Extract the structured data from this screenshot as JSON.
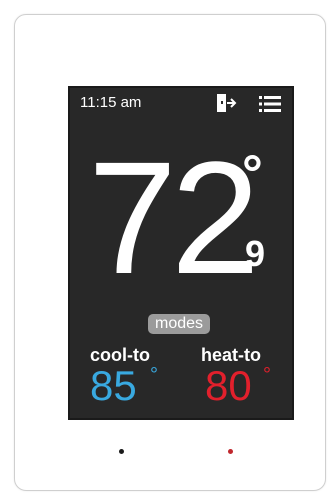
{
  "status_bar": {
    "time": "11:15 am",
    "icons": [
      "door-exit-icon",
      "menu-list-icon"
    ]
  },
  "current_temp": {
    "whole": "72",
    "degree_symbol": "°",
    "decimal": "9"
  },
  "modes_button": {
    "label": "modes"
  },
  "setpoints": {
    "cool": {
      "label": "cool-to",
      "value": "85",
      "degree_symbol": "°",
      "color": "#39a9e0"
    },
    "heat": {
      "label": "heat-to",
      "value": "80",
      "degree_symbol": "°",
      "color": "#e2202c"
    }
  },
  "colors": {
    "screen_bg": "#282828",
    "modes_bg": "#9b9b9b",
    "left_indicator": "#1a1a1a",
    "right_indicator": "#c0272d"
  },
  "indicators": [
    "left-led",
    "right-led"
  ]
}
